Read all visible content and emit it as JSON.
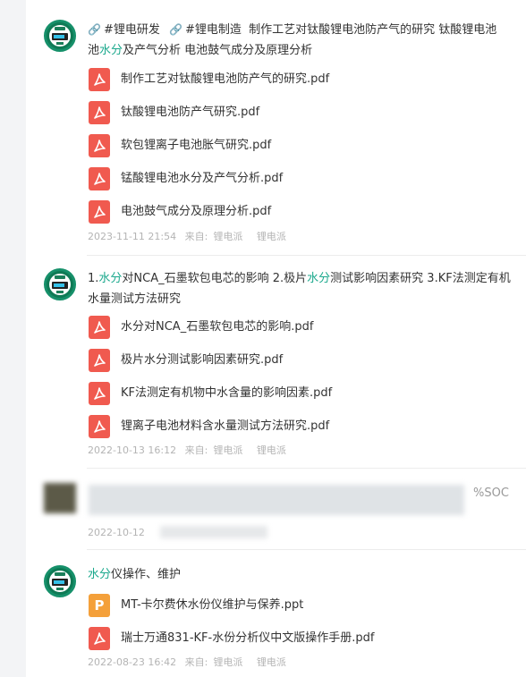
{
  "posts": [
    {
      "tags": [
        "#锂电研发",
        "#锂电制造"
      ],
      "title_lines": [
        "制作工艺对钛酸锂电池防产气的研究 钛酸锂电池",
        "池",
        "水分",
        "及产气分析 电池鼓气成分及原理分析"
      ],
      "files": [
        {
          "name": "制作工艺对钛酸锂电池防产气的研究.pdf",
          "icon": "pdf-icon"
        },
        {
          "name": "钛酸锂电池防产气研究.pdf",
          "icon": "pdf-icon"
        },
        {
          "name": "软包锂离子电池胀气研究.pdf",
          "icon": "pdf-icon"
        },
        {
          "name": "锰酸锂电池水分及产气分析.pdf",
          "icon": "pdf-icon"
        },
        {
          "name": "电池鼓气成分及原理分析.pdf",
          "icon": "pdf-icon"
        }
      ],
      "date": "2023-11-11 21:54",
      "source_label": "来自:",
      "source_name": "锂电派",
      "author": "锂电派"
    },
    {
      "title_lines": [
        "1.",
        "水分",
        "对NCA_石墨软包电芯的影响 2.极片",
        "水分",
        "测试影响因素研究 3.KF法测定有机",
        "水量测试方法研究"
      ],
      "files": [
        {
          "name": "水分对NCA_石墨软包电芯的影响.pdf",
          "icon": "pdf-icon"
        },
        {
          "name": "极片水分测试影响因素研究.pdf",
          "icon": "pdf-icon"
        },
        {
          "name": "KF法测定有机物中水含量的影响因素.pdf",
          "icon": "pdf-icon"
        },
        {
          "name": "锂离子电池材料含水量测试方法研究.pdf",
          "icon": "pdf-icon"
        }
      ],
      "date": "2022-10-13 16:12",
      "source_label": "来自:",
      "source_name": "锂电派",
      "author": "锂电派"
    },
    {
      "title_fragment": "%SOC",
      "date": "2022-10-12"
    },
    {
      "title_lines": [
        "水分",
        "仪操作、维护"
      ],
      "files": [
        {
          "name": "MT-卡尔费休水份仪维护与保养.ppt",
          "icon": "ppt-icon",
          "icon_letter": "P"
        },
        {
          "name": "瑞士万通831-KF-水份分析仪中文版操作手册.pdf",
          "icon": "pdf-icon"
        }
      ],
      "date": "2022-08-23 16:42",
      "source_label": "来自:",
      "source_name": "锂电派",
      "author": "锂电派"
    }
  ],
  "colors": {
    "highlight": "#1aa88c",
    "pdf": "#f05a4f",
    "ppt": "#f4a03a",
    "meta": "#b4b4b4"
  }
}
